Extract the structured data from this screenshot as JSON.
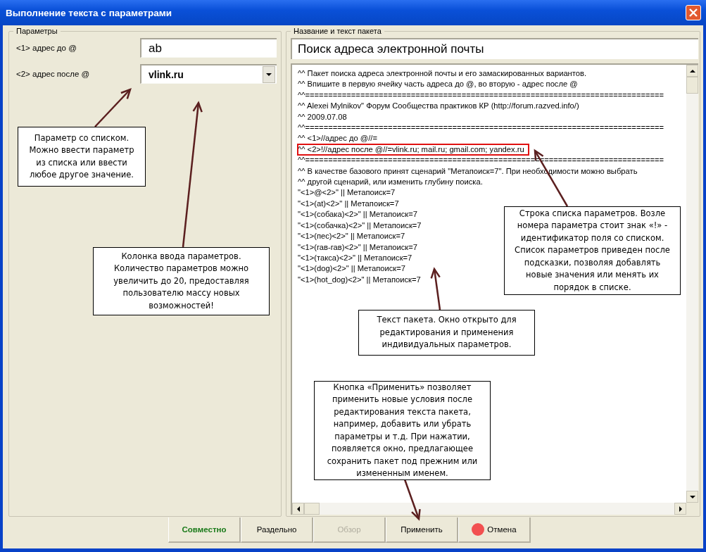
{
  "window": {
    "title": "Выполнение текста с параметрами"
  },
  "parameters": {
    "title": "Параметры",
    "fields": [
      {
        "kind": "text",
        "label": "<1> адрес до @",
        "value": "ab"
      },
      {
        "kind": "combo",
        "label": "<2> адрес после @",
        "value": "vlink.ru"
      }
    ]
  },
  "package": {
    "title": "Название и текст пакета",
    "name": "Поиск адреса электронной почты",
    "lines": [
      {
        "text": "^^ Пакет поиска адреса электронной почты и его замаскированных вариантов.",
        "highlighted": false
      },
      {
        "text": "^^ Впишите в первую ячейку часть адреса до @, во вторую - адрес после @",
        "highlighted": false
      },
      {
        "text": "^^==============================================================================",
        "highlighted": false
      },
      {
        "text": "^^ Alexei Mylnikov\" Форум Сообщества практиков КР (http://forum.razved.info/)",
        "highlighted": false
      },
      {
        "text": "^^ 2009.07.08",
        "highlighted": false
      },
      {
        "text": "^^==============================================================================",
        "highlighted": false
      },
      {
        "text": "^^ <1>//адрес до @//=",
        "highlighted": false
      },
      {
        "text": "^^ <2>!//адрес после @//=vlink.ru; mail.ru; gmail.com; yandex.ru",
        "highlighted": true
      },
      {
        "text": "^^==============================================================================",
        "highlighted": false
      },
      {
        "text": "^^ В качестве базового принят сценарий \"Метапоиск=7\". При необходимости можно выбрать",
        "highlighted": false
      },
      {
        "text": "^^ другой сценарий, или изменить глубину поиска.",
        "highlighted": false
      },
      {
        "text": "\"<1>@<2>\" || Метапоиск=7",
        "highlighted": false
      },
      {
        "text": "\"<1>(at)<2>\" || Метапоиск=7",
        "highlighted": false
      },
      {
        "text": "\"<1>(собака)<2>\" || Метапоиск=7",
        "highlighted": false
      },
      {
        "text": "\"<1>(собачка)<2>\" || Метапоиск=7",
        "highlighted": false
      },
      {
        "text": "\"<1>(пес)<2>\" || Метапоиск=7",
        "highlighted": false
      },
      {
        "text": "\"<1>(гав-гав)<2>\" || Метапоиск=7",
        "highlighted": false
      },
      {
        "text": "\"<1>(такса)<2>\" || Метапоиск=7",
        "highlighted": false
      },
      {
        "text": "\"<1>(dog)<2>\" || Метапоиск=7",
        "highlighted": false
      },
      {
        "text": "\"<1>(hot_dog)<2>\" || Метапоиск=7",
        "highlighted": false
      }
    ]
  },
  "buttons": [
    {
      "kind": "primary",
      "label": "Совместно",
      "disabled": false
    },
    {
      "kind": "normal",
      "label": "Раздельно",
      "disabled": false
    },
    {
      "kind": "normal",
      "label": "Обзор",
      "disabled": true
    },
    {
      "kind": "normal",
      "label": "Применить",
      "disabled": false
    },
    {
      "kind": "cancel",
      "label": "Отмена",
      "disabled": false
    }
  ],
  "annotations": [
    {
      "text": "Параметр со списком. Можно ввести параметр из списка или ввести любое другое значение."
    },
    {
      "text": "Колонка ввода параметров. Количество параметров можно увеличить до 20, предоставляя пользователю массу новых возможностей!"
    },
    {
      "text": "Строка списка параметров. Возле номера параметра стоит знак «!» - идентификатор поля со списком. Список параметров приведен после подсказки, позволяя добавлять новые значения или менять их порядок в списке."
    },
    {
      "text": "Текст пакета. Окно открыто для редактирования и применения индивидуальных параметров."
    },
    {
      "text": "Кнопка «Применить» позволяет применить новые условия после редактирования текста пакета, например, добавить или убрать параметры и т.д. При нажатии, появляется окно, предлагающее сохранить пакет под прежним или измененным именем."
    }
  ]
}
